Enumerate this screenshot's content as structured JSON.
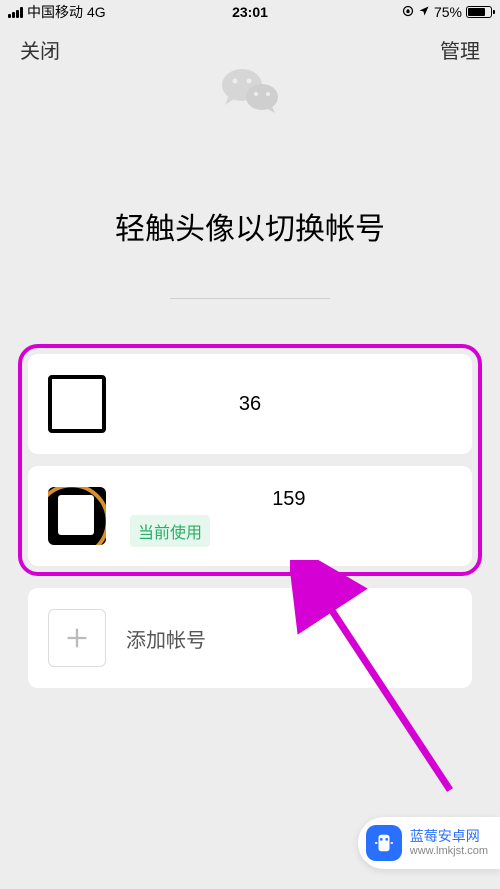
{
  "status": {
    "carrier": "中国移动",
    "network": "4G",
    "time": "23:01",
    "battery_pct": "75%"
  },
  "nav": {
    "close": "关闭",
    "manage": "管理"
  },
  "title": "轻触头像以切换帐号",
  "accounts": [
    {
      "name": "36"
    },
    {
      "name": "159",
      "current_label": "当前使用"
    }
  ],
  "add_account": "添加帐号",
  "watermark": {
    "name": "蓝莓安卓网",
    "url": "www.lmkjst.com"
  }
}
